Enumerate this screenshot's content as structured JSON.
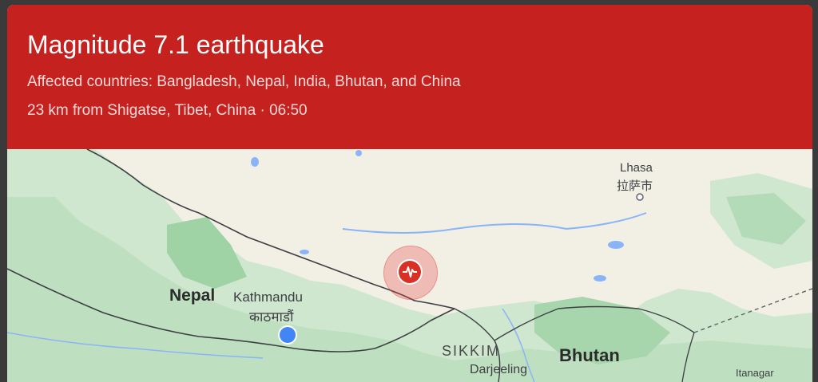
{
  "alert": {
    "title": "Magnitude 7.1 earthquake",
    "affected": "Affected countries: Bangladesh, Nepal, India, Bhutan, and China",
    "location_time": "23 km from Shigatse, Tibet, China · 06:50",
    "banner_color": "#c5221f"
  },
  "map": {
    "labels": {
      "nepal": "Nepal",
      "kathmandu": "Kathmandu",
      "kathmandu_native": "काठमाडौं",
      "lhasa": "Lhasa",
      "lhasa_native": "拉萨市",
      "sikkim": "SIKKIM",
      "bhutan": "Bhutan",
      "darjeeling": "Darjeeling",
      "itanagar": "Itanagar"
    },
    "markers": {
      "epicenter_icon": "earthquake-seismograph-icon",
      "epicenter_color": "#d93025",
      "user_location_color": "#4285f4"
    }
  }
}
